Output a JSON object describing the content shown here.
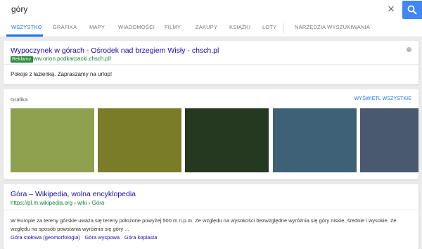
{
  "search": {
    "query": "góry"
  },
  "tabs": [
    "WSZYSTKO",
    "GRAFIKA",
    "MAPY",
    "WIADOMOŚCI",
    "FILMY",
    "ZAKUPY",
    "KSIĄŻKI",
    "LOTY",
    "NARZĘDZIA WYSZUKIWANIA"
  ],
  "active_tab": "WSZYSTKO",
  "ad": {
    "title": "Wypoczynek w górach - Ośrodek nad brzegiem Wisły - chsch.pl",
    "badge": "Reklama",
    "url": "www.orion.podkarpacki.chsch.pl/",
    "description": "Pokoje z łazienką. Zapraszamy na urlop!"
  },
  "images": {
    "header": "Grafika",
    "show_all": "WYŚWIETL WSZYSTKIE",
    "thumb_colors": [
      "#8fa04f",
      "#7b7c28",
      "#243920",
      "#3e6177",
      "#4a5a6e"
    ]
  },
  "result": {
    "title": "Góra – Wikipedia, wolna encyklopedia",
    "url": "https://pl.m.wikipedia.org › wiki › Góra",
    "snippet": "W Europie za tereny górskie uważa się tereny położone powyżej 500 m n.p.m. Ze względu na wysokości bezwzględne wyróżnia się góry niskie, średnie i wysokie. Ze względu na sposób powstania wyróżnia się góry ...",
    "links": [
      "Góra stołowa (geomorfologia)",
      "Góra wyspowa",
      "Góra kopiasta"
    ]
  }
}
